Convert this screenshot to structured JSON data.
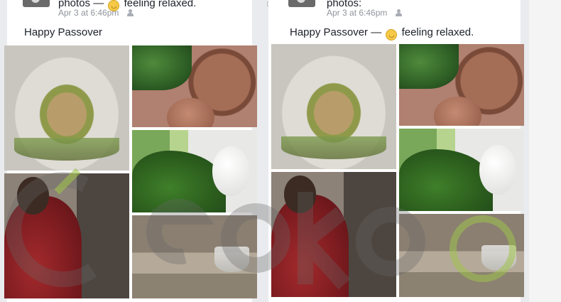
{
  "posts": [
    {
      "headline_prefix": "photos —",
      "feeling": "feeling relaxed.",
      "timestamp": "Apr 3 at 6:46pm",
      "body": "Happy Passover"
    },
    {
      "headline_prefix": "photos:",
      "timestamp": "Apr 3 at 6:46pm",
      "body_prefix": "Happy Passover —",
      "feeling": "feeling relaxed."
    }
  ],
  "photos": [
    {
      "name": "photo-quinoa-bowl",
      "subject": "grain bowl"
    },
    {
      "name": "photo-seder-plate",
      "subject": "seder plate with greens"
    },
    {
      "name": "photo-parsley-eggs",
      "subject": "parsley and eggs"
    },
    {
      "name": "photo-diners",
      "subject": "people at table"
    },
    {
      "name": "photo-table-glass",
      "subject": "table with glass"
    }
  ],
  "icons": {
    "audience": "friends-icon",
    "feeling": "smiley-face-icon",
    "selector": "radio-button-icon"
  },
  "colors": {
    "text_primary": "#1d2129",
    "text_secondary": "#90949c",
    "page_bg": "#e9ebee",
    "card_bg": "#ffffff",
    "watermark": "#9ec24a"
  }
}
